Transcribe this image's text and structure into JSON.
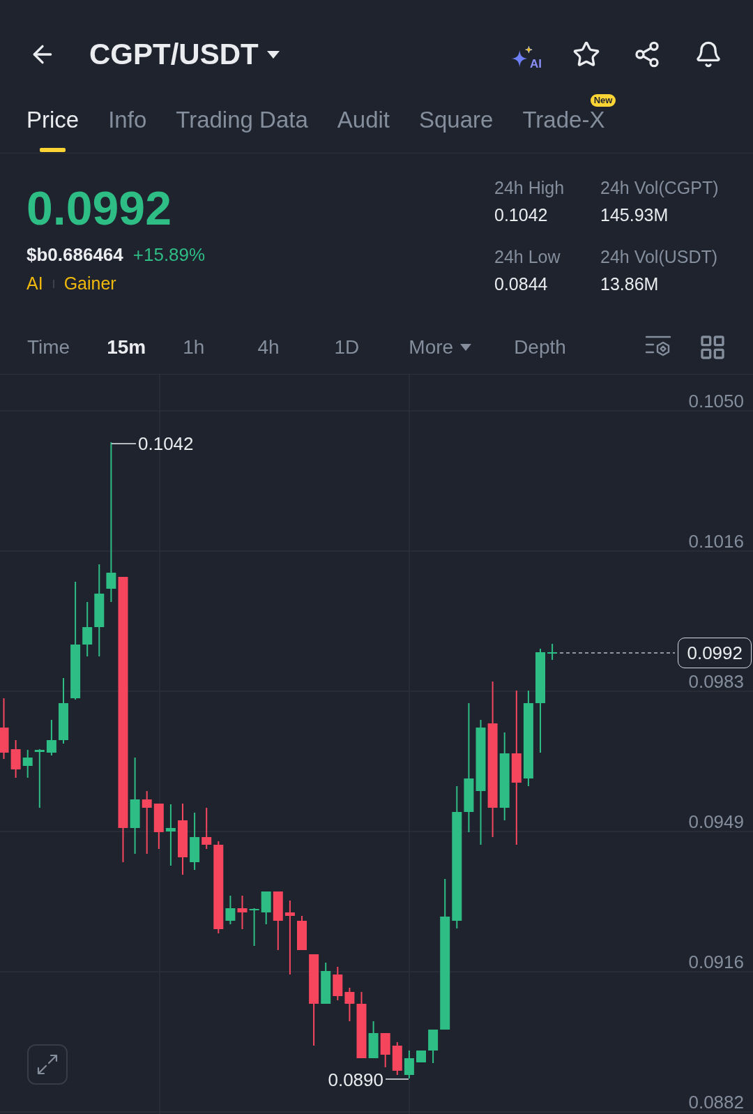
{
  "header": {
    "title": "CGPT/USDT",
    "ai_label": "AI"
  },
  "tabs": [
    {
      "label": "Price",
      "selected": true
    },
    {
      "label": "Info",
      "selected": false
    },
    {
      "label": "Trading Data",
      "selected": false
    },
    {
      "label": "Audit",
      "selected": false
    },
    {
      "label": "Square",
      "selected": false
    },
    {
      "label": "Trade-X",
      "selected": false,
      "badge": "New"
    }
  ],
  "ticker": {
    "last_price": "0.0992",
    "rising": true,
    "converted_price": "$b0.686464",
    "change": "+15.89%",
    "tags": [
      "AI",
      "Gainer"
    ]
  },
  "stats": [
    {
      "label": "24h High",
      "value": "0.1042"
    },
    {
      "label": "24h Vol(CGPT)",
      "value": "145.93M"
    },
    {
      "label": "24h Low",
      "value": "0.0844"
    },
    {
      "label": "24h Vol(USDT)",
      "value": "13.86M"
    }
  ],
  "intervals": [
    {
      "label": "Time",
      "kind": "option",
      "selected": false
    },
    {
      "label": "15m",
      "kind": "option",
      "selected": true
    },
    {
      "label": "1h",
      "kind": "option",
      "selected": false
    },
    {
      "label": "4h",
      "kind": "option",
      "selected": false
    },
    {
      "label": "1D",
      "kind": "option",
      "selected": false
    },
    {
      "label": "More",
      "kind": "menu",
      "selected": false
    },
    {
      "label": "Depth",
      "kind": "option",
      "selected": false
    }
  ],
  "chart": {
    "y_labels": [
      "0.1050",
      "0.1016",
      "0.0983",
      "0.0949",
      "0.0916",
      "0.0882"
    ],
    "high_label": "0.1042",
    "low_label": "0.0890",
    "last_price": "0.0992"
  }
}
